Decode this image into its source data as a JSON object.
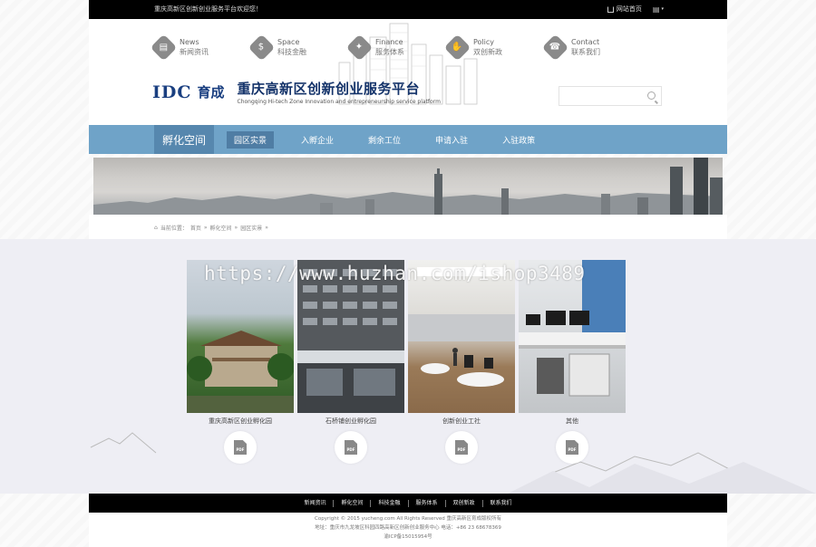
{
  "topbar": {
    "welcome": "重庆高新区创新创业服务平台欢迎您！",
    "home_label": "网站首页",
    "lang_label": "语言"
  },
  "quick_links": [
    {
      "en": "News",
      "zh": "新闻资讯",
      "icon": "newspaper-icon"
    },
    {
      "en": "Space",
      "zh": "科技金融",
      "icon": "money-bag-icon"
    },
    {
      "en": "Finance",
      "zh": "服务体系",
      "icon": "lightbulb-icon"
    },
    {
      "en": "Policy",
      "zh": "双创新政",
      "icon": "handshake-icon"
    },
    {
      "en": "Contact",
      "zh": "联系我们",
      "icon": "phone-icon"
    }
  ],
  "logo": {
    "idc": "IDC",
    "idc_zh": "育成",
    "title": "重庆高新区创新创业服务平台",
    "subtitle": "Chongqing Hi-tech Zone Innovation and entrepreneurship service platform"
  },
  "search": {
    "placeholder": ""
  },
  "nav": {
    "section_title": "孵化空间",
    "items": [
      {
        "label": "园区实景",
        "active": true
      },
      {
        "label": "入孵企业",
        "active": false
      },
      {
        "label": "剩余工位",
        "active": false
      },
      {
        "label": "申请入驻",
        "active": false
      },
      {
        "label": "入驻政策",
        "active": false
      }
    ]
  },
  "breadcrumb": [
    "当前位置：",
    "首页",
    "孵化空间",
    "园区实景"
  ],
  "cards": [
    {
      "caption": "重庆高新区创业孵化园"
    },
    {
      "caption": "石桥铺创业孵化园"
    },
    {
      "caption": "创新创业工社"
    },
    {
      "caption": "其他"
    }
  ],
  "pdf_label": "PDF",
  "watermark": "https://www.huzhan.com/ishop3489",
  "footer": {
    "links": [
      "新闻资讯",
      "孵化空间",
      "科技金融",
      "服务体系",
      "双创新政",
      "联系我们"
    ],
    "copyright": "Copyright © 2015 yucheng.com All Rights Reserved 重庆高新区育成版权所有",
    "address": "地址：重庆市九龙坡区科园四路高新区创新创业服务中心 电话：+86 23 68678369",
    "icp": "渝ICP备15015954号"
  },
  "colors": {
    "nav": "#6fa3c8",
    "nav_section": "#5687ae",
    "brand": "#1a3f80"
  }
}
